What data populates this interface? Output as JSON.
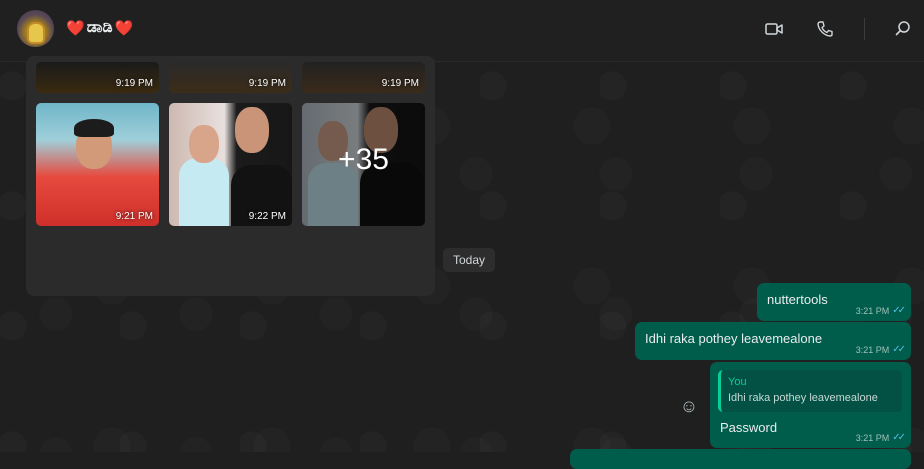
{
  "header": {
    "avatar_icon": "avatar-image",
    "title_heart_left": "❤️",
    "title_text": "ಡಾಡಿ",
    "title_heart_right": "❤️",
    "icons": [
      "video-call-icon",
      "phone-icon",
      "search-icon"
    ]
  },
  "media": {
    "tiles": [
      {
        "time": "9:19 PM"
      },
      {
        "time": "9:19 PM"
      },
      {
        "time": "9:19 PM"
      },
      {
        "time": "9:21 PM"
      },
      {
        "time": "9:22 PM"
      },
      {
        "more_label": "+35"
      }
    ]
  },
  "date_divider": "Today",
  "messages": [
    {
      "text": "nuttertools",
      "time": "3:21 PM",
      "status": "✓✓"
    },
    {
      "text": "Idhi raka pothey leavemealone",
      "time": "3:21 PM",
      "status": "✓✓"
    },
    {
      "reply": {
        "author": "You",
        "text": "Idhi raka pothey leavemealone"
      },
      "text": "Password",
      "time": "3:21 PM",
      "status": "✓✓"
    }
  ],
  "colors": {
    "background": "#1f1f1f",
    "header": "#202020",
    "outgoing_bubble": "#005c4b",
    "read_tick": "#53bdeb",
    "quote_accent": "#06cf9c"
  }
}
